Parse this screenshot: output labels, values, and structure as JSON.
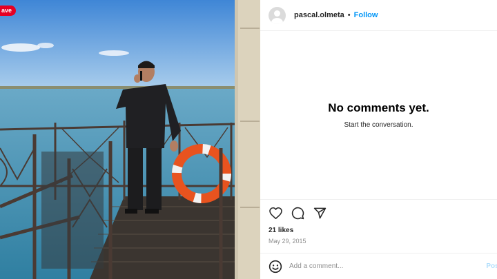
{
  "photo": {
    "save_badge": "ave",
    "alt": "Man on phone standing on a metal balcony by the sea with a life ring"
  },
  "post": {
    "username": "pascal.olmeta",
    "separator": "•",
    "follow_label": "Follow"
  },
  "comments": {
    "empty_title": "No comments yet.",
    "empty_subtitle": "Start the conversation."
  },
  "actions": {
    "icons": [
      "heart-icon",
      "comment-icon",
      "share-icon"
    ]
  },
  "stats": {
    "likes": "21 likes",
    "date": "May 29, 2015"
  },
  "add_comment": {
    "placeholder": "Add a comment...",
    "post_label": "Post"
  },
  "colors": {
    "accent": "#0095f6",
    "save_red": "#e60023",
    "muted": "#8e8e8e"
  }
}
